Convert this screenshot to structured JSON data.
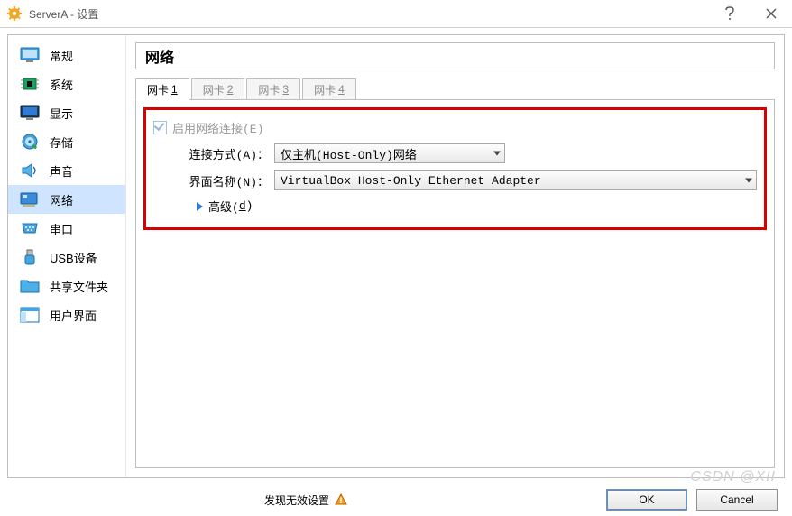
{
  "window": {
    "title": "ServerA - 设置",
    "help_icon": "help-icon",
    "close_icon": "close-icon"
  },
  "sidebar": {
    "items": [
      {
        "label": "常规",
        "icon": "general"
      },
      {
        "label": "系统",
        "icon": "system"
      },
      {
        "label": "显示",
        "icon": "display"
      },
      {
        "label": "存储",
        "icon": "storage"
      },
      {
        "label": "声音",
        "icon": "audio"
      },
      {
        "label": "网络",
        "icon": "network"
      },
      {
        "label": "串口",
        "icon": "serial"
      },
      {
        "label": "USB设备",
        "icon": "usb"
      },
      {
        "label": "共享文件夹",
        "icon": "shared"
      },
      {
        "label": "用户界面",
        "icon": "ui"
      }
    ],
    "selected_index": 5
  },
  "panel": {
    "heading": "网络",
    "tabs": [
      {
        "prefix": "网卡 ",
        "hot": "1"
      },
      {
        "prefix": "网卡 ",
        "hot": "2"
      },
      {
        "prefix": "网卡 ",
        "hot": "3"
      },
      {
        "prefix": "网卡 ",
        "hot": "4"
      }
    ],
    "active_tab": 0,
    "enable_label_full": "启用网络连接(E)",
    "enable_checked": true,
    "attach_label": "连接方式(A)：",
    "attach_value": "仅主机(Host-Only)网络",
    "iface_label": "界面名称(N)：",
    "iface_value": "VirtualBox Host-Only Ethernet Adapter",
    "advanced_label": "高级(d)",
    "advanced_prefix": "高级(",
    "advanced_hot": "d",
    "advanced_suffix": ")"
  },
  "footer": {
    "status": "发现无效设置",
    "ok": "OK",
    "cancel": "Cancel"
  },
  "watermark": "CSDN @XII"
}
